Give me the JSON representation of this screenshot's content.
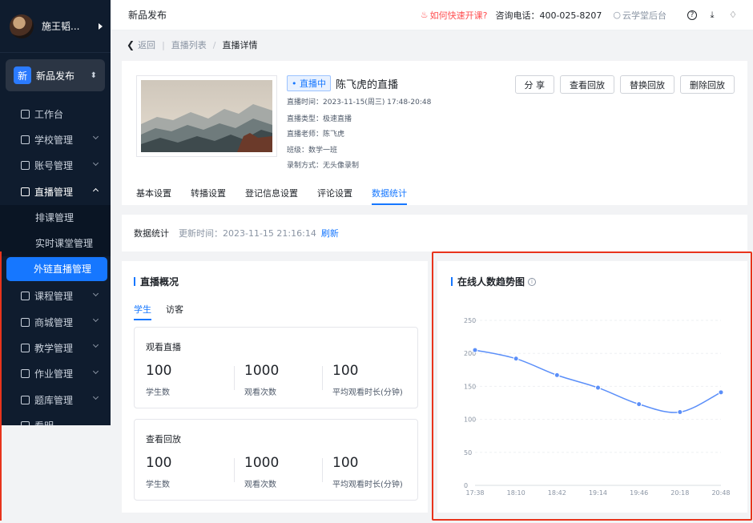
{
  "sidebar": {
    "user_name": "施王韬...",
    "org": {
      "badge": "新",
      "name": "新品发布"
    },
    "items": [
      {
        "label": "工作台",
        "icon": "dashboard-icon",
        "has_chevron": false
      },
      {
        "label": "学校管理",
        "icon": "school-icon",
        "has_chevron": true
      },
      {
        "label": "账号管理",
        "icon": "account-icon",
        "has_chevron": true
      },
      {
        "label": "直播管理",
        "icon": "live-icon",
        "has_chevron": true,
        "open": true
      },
      {
        "label": "课程管理",
        "icon": "course-icon",
        "has_chevron": true
      },
      {
        "label": "商城管理",
        "icon": "shop-icon",
        "has_chevron": true
      },
      {
        "label": "教学管理",
        "icon": "teaching-icon",
        "has_chevron": true
      },
      {
        "label": "作业管理",
        "icon": "homework-icon",
        "has_chevron": true
      },
      {
        "label": "题库管理",
        "icon": "question-bank-icon",
        "has_chevron": true
      },
      {
        "label": "看明",
        "icon": "view-icon",
        "has_chevron": false
      }
    ],
    "sub_items": [
      "排课管理",
      "实时课堂管理",
      "外链直播管理"
    ],
    "active_sub": "外链直播管理"
  },
  "topbar": {
    "title": "新品发布",
    "quick_start": "如何快速开课?",
    "hotline": "咨询电话：400-025-8207",
    "cloud_admin": "云学堂后台"
  },
  "breadcrumb": {
    "back": "返回",
    "list": "直播列表",
    "current": "直播详情"
  },
  "live": {
    "status": "• 直播中",
    "title": "陈飞虎的直播",
    "time": "直播时间：2023-11-15(周三) 17:48-20:48",
    "type": "直播类型：极速直播",
    "teacher": "直播老师：陈飞虎",
    "class": "班级：数学一班",
    "record": "录制方式：无头像录制",
    "actions": [
      "分 享",
      "查看回放",
      "替换回放",
      "删除回放"
    ],
    "tabs": [
      "基本设置",
      "转播设置",
      "登记信息设置",
      "评论设置",
      "数据统计"
    ],
    "active_tab": "数据统计"
  },
  "stats": {
    "label": "数据统计",
    "updated": "更新时间：2023-11-15 21:16:14",
    "refresh": "刷新"
  },
  "overview": {
    "title": "直播概况",
    "sub_tabs": [
      "学生",
      "访客"
    ],
    "active_sub_tab": "学生",
    "live_watch": {
      "title": "观看直播",
      "metrics": [
        {
          "value": "100",
          "label": "学生数"
        },
        {
          "value": "1000",
          "label": "观看次数"
        },
        {
          "value": "100",
          "label": "平均观看时长(分钟)"
        }
      ]
    },
    "replay_watch": {
      "title": "查看回放",
      "metrics": [
        {
          "value": "100",
          "label": "学生数"
        },
        {
          "value": "1000",
          "label": "观看次数"
        },
        {
          "value": "100",
          "label": "平均观看时长(分钟)"
        }
      ]
    }
  },
  "trend": {
    "title": "在线人数趋势图",
    "info_icon": "info-icon"
  },
  "colors": {
    "accent": "#1677ff",
    "highlight": "#e8341c",
    "sidebar_bg": "#0f1c2e",
    "line": "#5b8ff9"
  },
  "chart_data": {
    "type": "line",
    "x": [
      "17:38",
      "18:10",
      "18:42",
      "19:14",
      "19:46",
      "20:18",
      "20:48"
    ],
    "series": [
      {
        "values": [
          205,
          192,
          167,
          148,
          123,
          111,
          141
        ]
      }
    ],
    "ylim": [
      0,
      250
    ],
    "yticks": [
      0,
      50,
      100,
      150,
      200,
      250
    ],
    "grid": true,
    "smooth": true,
    "title": "",
    "xlabel": "",
    "ylabel": ""
  }
}
